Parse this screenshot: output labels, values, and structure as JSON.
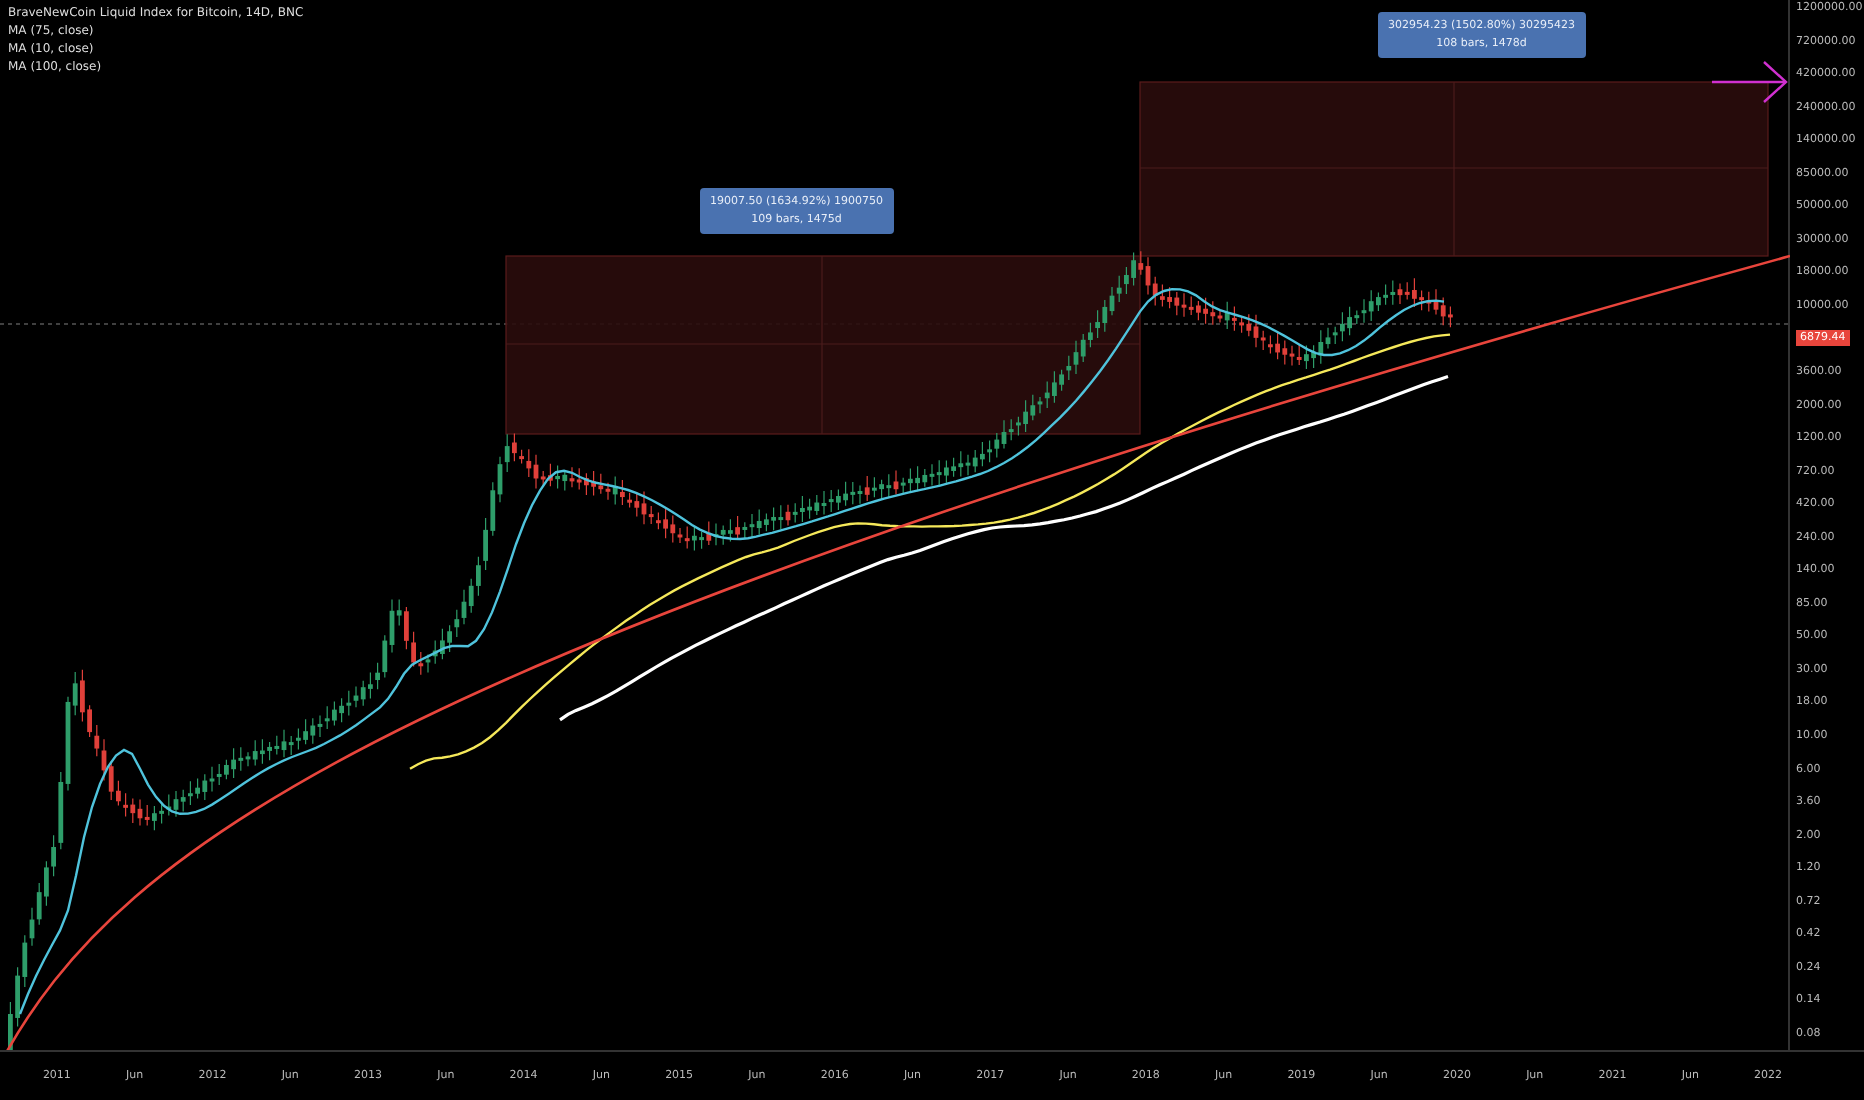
{
  "legend": {
    "title": "BraveNewCoin Liquid Index for Bitcoin, 14D, BNC",
    "indicators": [
      "MA (75, close)",
      "MA (10, close)",
      "MA (100, close)"
    ]
  },
  "ranges": [
    {
      "line_1": "19007.50 (1634.92%) 1900750",
      "line_2": "109 bars, 1475d"
    },
    {
      "line_1": "302954.23 (1502.80%) 30295423",
      "line_2": "108 bars, 1478d"
    }
  ],
  "y_axis": [
    {
      "kind": "tick",
      "label": "1200000.00"
    },
    {
      "kind": "tick",
      "label": "720000.00"
    },
    {
      "kind": "tick",
      "label": "420000.00"
    },
    {
      "kind": "tick",
      "label": "240000.00"
    },
    {
      "kind": "tick",
      "label": "140000.00"
    },
    {
      "kind": "tick",
      "label": "85000.00"
    },
    {
      "kind": "tick",
      "label": "50000.00"
    },
    {
      "kind": "tick",
      "label": "30000.00"
    },
    {
      "kind": "tick",
      "label": "18000.00"
    },
    {
      "kind": "tick",
      "label": "10000.00"
    },
    {
      "kind": "price",
      "label": "6879.44"
    },
    {
      "kind": "tick",
      "label": "3600.00"
    },
    {
      "kind": "tick",
      "label": "2000.00"
    },
    {
      "kind": "tick",
      "label": "1200.00"
    },
    {
      "kind": "tick",
      "label": "720.00"
    },
    {
      "kind": "tick",
      "label": "420.00"
    },
    {
      "kind": "tick",
      "label": "240.00"
    },
    {
      "kind": "tick",
      "label": "140.00"
    },
    {
      "kind": "tick",
      "label": "85.00"
    },
    {
      "kind": "tick",
      "label": "50.00"
    },
    {
      "kind": "tick",
      "label": "30.00"
    },
    {
      "kind": "tick",
      "label": "18.00"
    },
    {
      "kind": "tick",
      "label": "10.00"
    },
    {
      "kind": "tick",
      "label": "6.00"
    },
    {
      "kind": "tick",
      "label": "3.60"
    },
    {
      "kind": "tick",
      "label": "2.00"
    },
    {
      "kind": "tick",
      "label": "1.20"
    },
    {
      "kind": "tick",
      "label": "0.72"
    },
    {
      "kind": "tick",
      "label": "0.42"
    },
    {
      "kind": "tick",
      "label": "0.24"
    },
    {
      "kind": "tick",
      "label": "0.14"
    },
    {
      "kind": "tick",
      "label": "0.08"
    }
  ],
  "x_axis": [
    "2011",
    "Jun",
    "2012",
    "Jun",
    "2013",
    "Jun",
    "2014",
    "Jun",
    "2015",
    "Jun",
    "2016",
    "Jun",
    "2017",
    "Jun",
    "2018",
    "Jun",
    "2019",
    "Jun",
    "2020",
    "Jun",
    "2021",
    "Jun",
    "2022"
  ]
}
